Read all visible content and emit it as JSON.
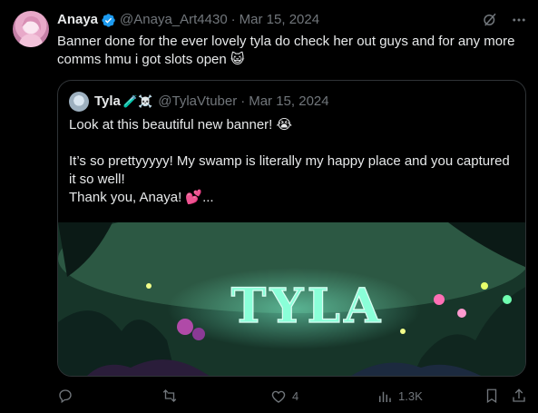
{
  "tweet": {
    "author_name": "Anaya",
    "author_handle": "@Anaya_Art4430",
    "separator": "·",
    "date": "Mar 15, 2024",
    "text": "Banner done for the ever lovely tyla do check her out guys and for any more comms hmu i got slots open 😺"
  },
  "quoted": {
    "author_name": "Tyla",
    "name_emojis": "🧪☠️",
    "author_handle": "@TylaVtuber",
    "separator": "·",
    "date": "Mar 15, 2024",
    "text": "Look at this beautiful new banner! 😭\n\nIt’s so prettyyyyy! My swamp is literally my happy place and you captured it so well!\nThank you, Anaya! 💕...",
    "banner_title": "TYLA"
  },
  "actions": {
    "replies": "",
    "reposts": "",
    "likes": "4",
    "views": "1.3K"
  },
  "colors": {
    "background": "#000000",
    "text": "#e7e9ea",
    "muted": "#71767b",
    "verified": "#1d9bf0",
    "border": "#2f3336"
  }
}
